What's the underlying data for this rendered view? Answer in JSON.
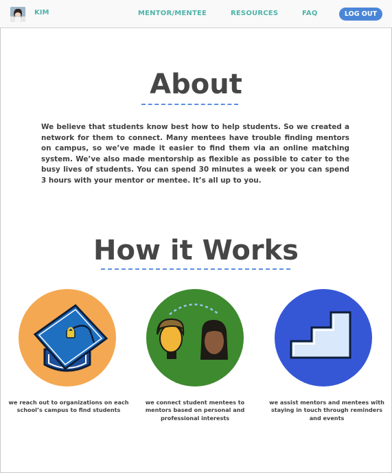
{
  "nav": {
    "user_name": "KIM",
    "links": [
      "MENTOR/MENTEE",
      "RESOURCES",
      "FAQ"
    ],
    "logout_label": "LOG OUT"
  },
  "about": {
    "title": "About",
    "body": "We believe that students know best how to help students. So we created a network for them to connect. Many mentees have trouble finding mentors on campus, so we’ve made it easier to find them via an online matching system. We’ve also made mentorship as flexible as possible to cater to the busy lives of students. You can spend 30 minutes a week or you can spend 3 hours with your mentor or mentee. It’s all up to you."
  },
  "how": {
    "title": "How it Works",
    "steps": [
      {
        "icon": "graduation-cap-icon",
        "caption": "we reach out to organizations on each school’s campus to find students"
      },
      {
        "icon": "two-people-icon",
        "caption": "we connect student mentees to mentors based on personal and professional interests"
      },
      {
        "icon": "stairs-icon",
        "caption": "we assist mentors and mentees with staying in touch through reminders and events"
      }
    ]
  },
  "colors": {
    "accent_teal": "#4fb3a9",
    "button_blue": "#4a86d8",
    "circle_orange": "#f4a851",
    "circle_green": "#3e8a2f",
    "circle_blue": "#3557d6"
  }
}
